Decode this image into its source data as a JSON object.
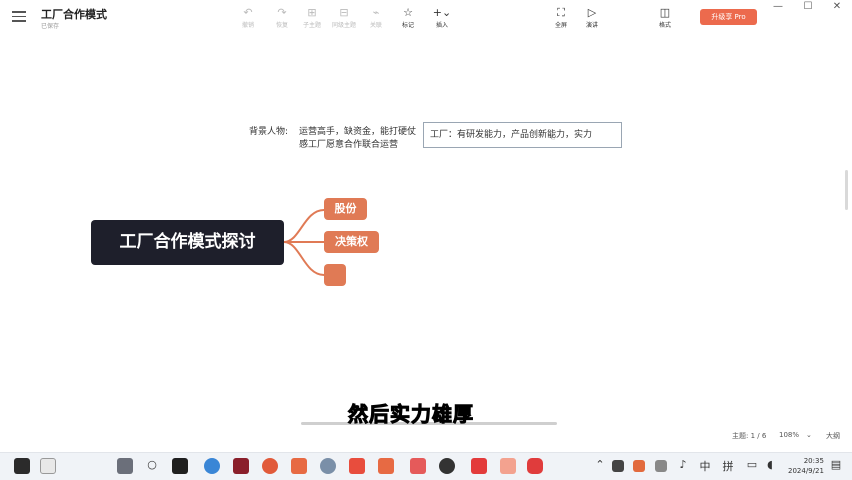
{
  "window": {
    "title": "工厂合作模式",
    "subtitle": "已保存",
    "menu_icon": "hamburger-icon"
  },
  "toolbar": {
    "tools": [
      {
        "label": "撤销",
        "icon": "undo-icon",
        "glyph": "↶"
      },
      {
        "label": "恢复",
        "icon": "redo-icon",
        "glyph": "↷"
      },
      {
        "label": "子主题",
        "icon": "subtopic-icon",
        "glyph": "⊞"
      },
      {
        "label": "同级主题",
        "icon": "sibling-topic-icon",
        "glyph": "⊟"
      },
      {
        "label": "关联",
        "icon": "relation-icon",
        "glyph": "⌁"
      },
      {
        "label": "标记",
        "icon": "mark-icon",
        "glyph": "☆"
      },
      {
        "label": "插入",
        "icon": "insert-icon",
        "glyph": "+⌄"
      },
      {
        "label": "全屏",
        "icon": "fullscreen-icon",
        "glyph": "⛶"
      },
      {
        "label": "演讲",
        "icon": "present-icon",
        "glyph": "▷"
      },
      {
        "label": "格式",
        "icon": "format-icon",
        "glyph": "◫"
      }
    ],
    "pro_label": "升级享 Pro",
    "window_controls": [
      "—",
      "☐",
      "✕"
    ]
  },
  "canvas": {
    "background_label": "背景人物:",
    "background_line1": "运营高手，缺资金，能打硬仗",
    "background_line2": "感工厂愿意合作联合运营",
    "editing_text": "工厂：有研发能力，产品创新能力，实力",
    "central_topic": "工厂合作模式探讨",
    "branches": [
      {
        "label": "股份"
      },
      {
        "label": "决策权"
      },
      {
        "label": ""
      }
    ],
    "colors": {
      "central_bg": "#1e1f2b",
      "branch_bg": "#e07a55",
      "link": "#e07a55"
    }
  },
  "subtitle_caption": "然后实力雄厚",
  "statusbar": {
    "topic_count": "主题: 1 / 6",
    "zoom": "108%",
    "outline": "大纲"
  },
  "taskbar": {
    "time": "20:35",
    "date": "2024/9/21",
    "ime": "中",
    "ime2": "拼"
  }
}
